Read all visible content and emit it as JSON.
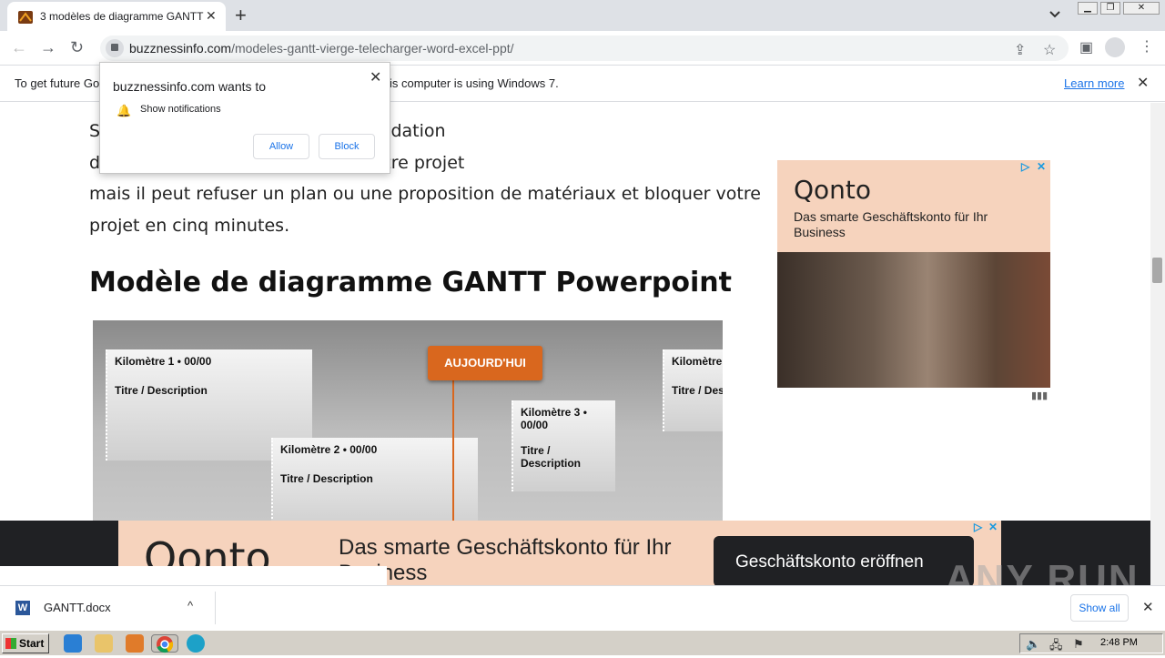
{
  "tab": {
    "title": "3 modèles de diagramme GANTT vierge",
    "close": "✕",
    "new": "+"
  },
  "window": {
    "minimize": "▁",
    "restore": "❐",
    "close": "✕"
  },
  "toolbar": {
    "back": "←",
    "forward": "→",
    "reload": "↻",
    "url_host": "buzznessinfo.com",
    "url_path": "/modeles-gantt-vierge-telecharger-word-excel-ppt/",
    "share": "⇪",
    "star": "☆",
    "sidepanel": "▣",
    "menu": "⋮"
  },
  "infobar": {
    "message_start": "To get future Go",
    "message_end": "is computer is using Windows 7.",
    "learn_more": "Learn more",
    "close": "✕"
  },
  "notification": {
    "title": "buzznessinfo.com wants to",
    "permission": "Show notifications",
    "allow": "Allow",
    "block": "Block",
    "close": "✕"
  },
  "article": {
    "lines": [
      "S                                               et de bâtiment soumis à une validation",
      "d                                              u impliqué au quotidien dans votre projet",
      "mais il peut refuser un plan ou une proposition de matériaux et bloquer votre",
      "projet en cinq minutes."
    ],
    "heading": "Modèle de diagramme GANTT Powerpoint"
  },
  "gantt": {
    "today": "AUJOURD'HUI",
    "boxes": [
      {
        "km": "Kilomètre 1 • 00/00",
        "desc": "Titre / Description"
      },
      {
        "km": "Kilomètre 2 • 00/00",
        "desc": "Titre / Description"
      },
      {
        "km": "Kilomètre 3 • 00/00",
        "desc": "Titre / Description"
      },
      {
        "km": "Kilomètre",
        "desc": "Titre / Des"
      }
    ]
  },
  "ad_right": {
    "brand": "Qonto",
    "copy": "Das smarte Geschäftskonto für Ihr Business",
    "play": "▷",
    "close": "✕"
  },
  "ad_bottom": {
    "brand": "Qonto",
    "copy": "Das smarte Geschäftskonto für Ihr Business",
    "cta": "Geschäftskonto eröffnen",
    "play": "▷",
    "close": "✕"
  },
  "status_url": "",
  "download": {
    "filename": "GANTT.docx",
    "icon": "W",
    "chevron": "^",
    "show_all": "Show all",
    "close": "✕"
  },
  "watermark": "ANY RUN",
  "taskbar": {
    "start": "Start",
    "clock": "2:48 PM"
  }
}
